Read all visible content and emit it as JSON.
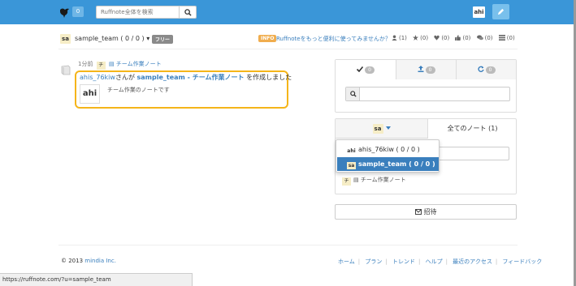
{
  "header": {
    "notification_count": "0",
    "search_placeholder": "Ruffnote全体を検索",
    "user_avatar_text": "ahi",
    "colors": {
      "bar": "#3a96d8",
      "accent": "#3a7fbd",
      "highlight": "#f5b51a"
    },
    "icons": [
      "bird-logo-icon",
      "search-icon",
      "pencil-icon"
    ]
  },
  "team": {
    "avatar_text": "sa",
    "name": "sample_team ( 0 / 0 )",
    "plan_badge": "フリー",
    "info_badge": "INFO",
    "info_text": "Ruffnoteをもっと便利に使ってみませんか？",
    "stats": [
      {
        "icon": "user-icon",
        "value": "(1)"
      },
      {
        "icon": "star-icon",
        "value": "(0)"
      },
      {
        "icon": "heart-icon",
        "value": "(0)"
      },
      {
        "icon": "thumbs-up-icon",
        "value": "(0)"
      },
      {
        "icon": "comments-icon",
        "value": "(0)"
      },
      {
        "icon": "list-icon",
        "value": "(0)"
      }
    ]
  },
  "feed": {
    "time": "1分前",
    "note_chip": "チ",
    "note_link": "チーム作業ノート",
    "user": "ahis_76kiw",
    "text_san": "さんが",
    "target": "sample_team - チーム作業ノート",
    "action": "を作成しました",
    "avatar_text": "ahi",
    "description": "チーム作業のノートです"
  },
  "panel": {
    "tabs": [
      {
        "icon": "check-icon",
        "count": "0"
      },
      {
        "icon": "upload-icon",
        "count": "0"
      },
      {
        "icon": "refresh-icon",
        "count": "0"
      }
    ]
  },
  "team_panel": {
    "selector_avatar": "sa",
    "all_notes_tab": "全てのノート (1)",
    "note_chip": "チ",
    "note_label": "チーム作業ノート",
    "invite_label": "招待"
  },
  "dropdown": {
    "items": [
      {
        "avatar": "ahi",
        "label": "ahis_76kiw ( 0 / 0 )",
        "selected": false
      },
      {
        "avatar": "sa",
        "label": "sample_team ( 0 / 0 )",
        "selected": true
      }
    ]
  },
  "footer": {
    "copyright_prefix": "© 2013 ",
    "company": "mindia Inc.",
    "links": [
      "ホーム",
      "プラン",
      "トレンド",
      "ヘルプ",
      "最近のアクセス",
      "フィードバック"
    ]
  },
  "statusbar": {
    "url": "https://ruffnote.com/?u=sample_team"
  }
}
